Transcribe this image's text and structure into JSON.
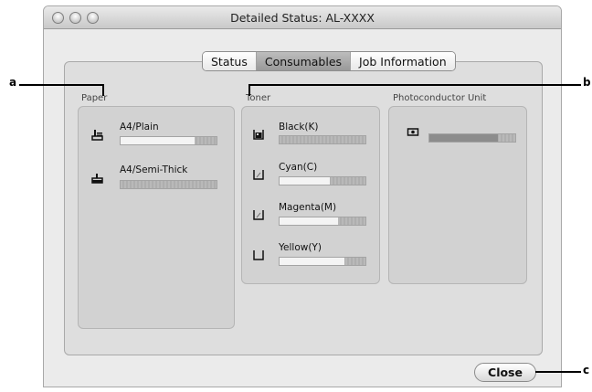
{
  "window": {
    "title": "Detailed Status: AL-XXXX"
  },
  "tabs": [
    {
      "label": "Status",
      "selected": false
    },
    {
      "label": "Consumables",
      "selected": true
    },
    {
      "label": "Job Information",
      "selected": false
    }
  ],
  "paper": {
    "label": "Paper",
    "items": [
      {
        "label": "A4/Plain",
        "icon": "paper-tray-icon",
        "level": 0.77
      },
      {
        "label": "A4/Semi-Thick",
        "icon": "paper-tray-icon",
        "level": 0.0
      }
    ]
  },
  "toner": {
    "label": "Toner",
    "items": [
      {
        "label": "Black(K)",
        "icon": "toner-cartridge-icon",
        "level": 0.0
      },
      {
        "label": "Cyan(C)",
        "icon": "toner-cartridge-icon",
        "level": 0.58
      },
      {
        "label": "Magenta(M)",
        "icon": "toner-cartridge-icon",
        "level": 0.68
      },
      {
        "label": "Yellow(Y)",
        "icon": "toner-cartridge-icon",
        "level": 0.75
      }
    ]
  },
  "photoconductor": {
    "label": "Photoconductor Unit",
    "level": 0.8
  },
  "buttons": {
    "close_label": "Close"
  },
  "callouts": {
    "a": "a",
    "b": "b",
    "c": "c"
  },
  "colors": {
    "bar_fill": "#f4f4f4",
    "bar_fill_dark": "#8c8c8c",
    "bar_track": "#b4b4b4"
  }
}
